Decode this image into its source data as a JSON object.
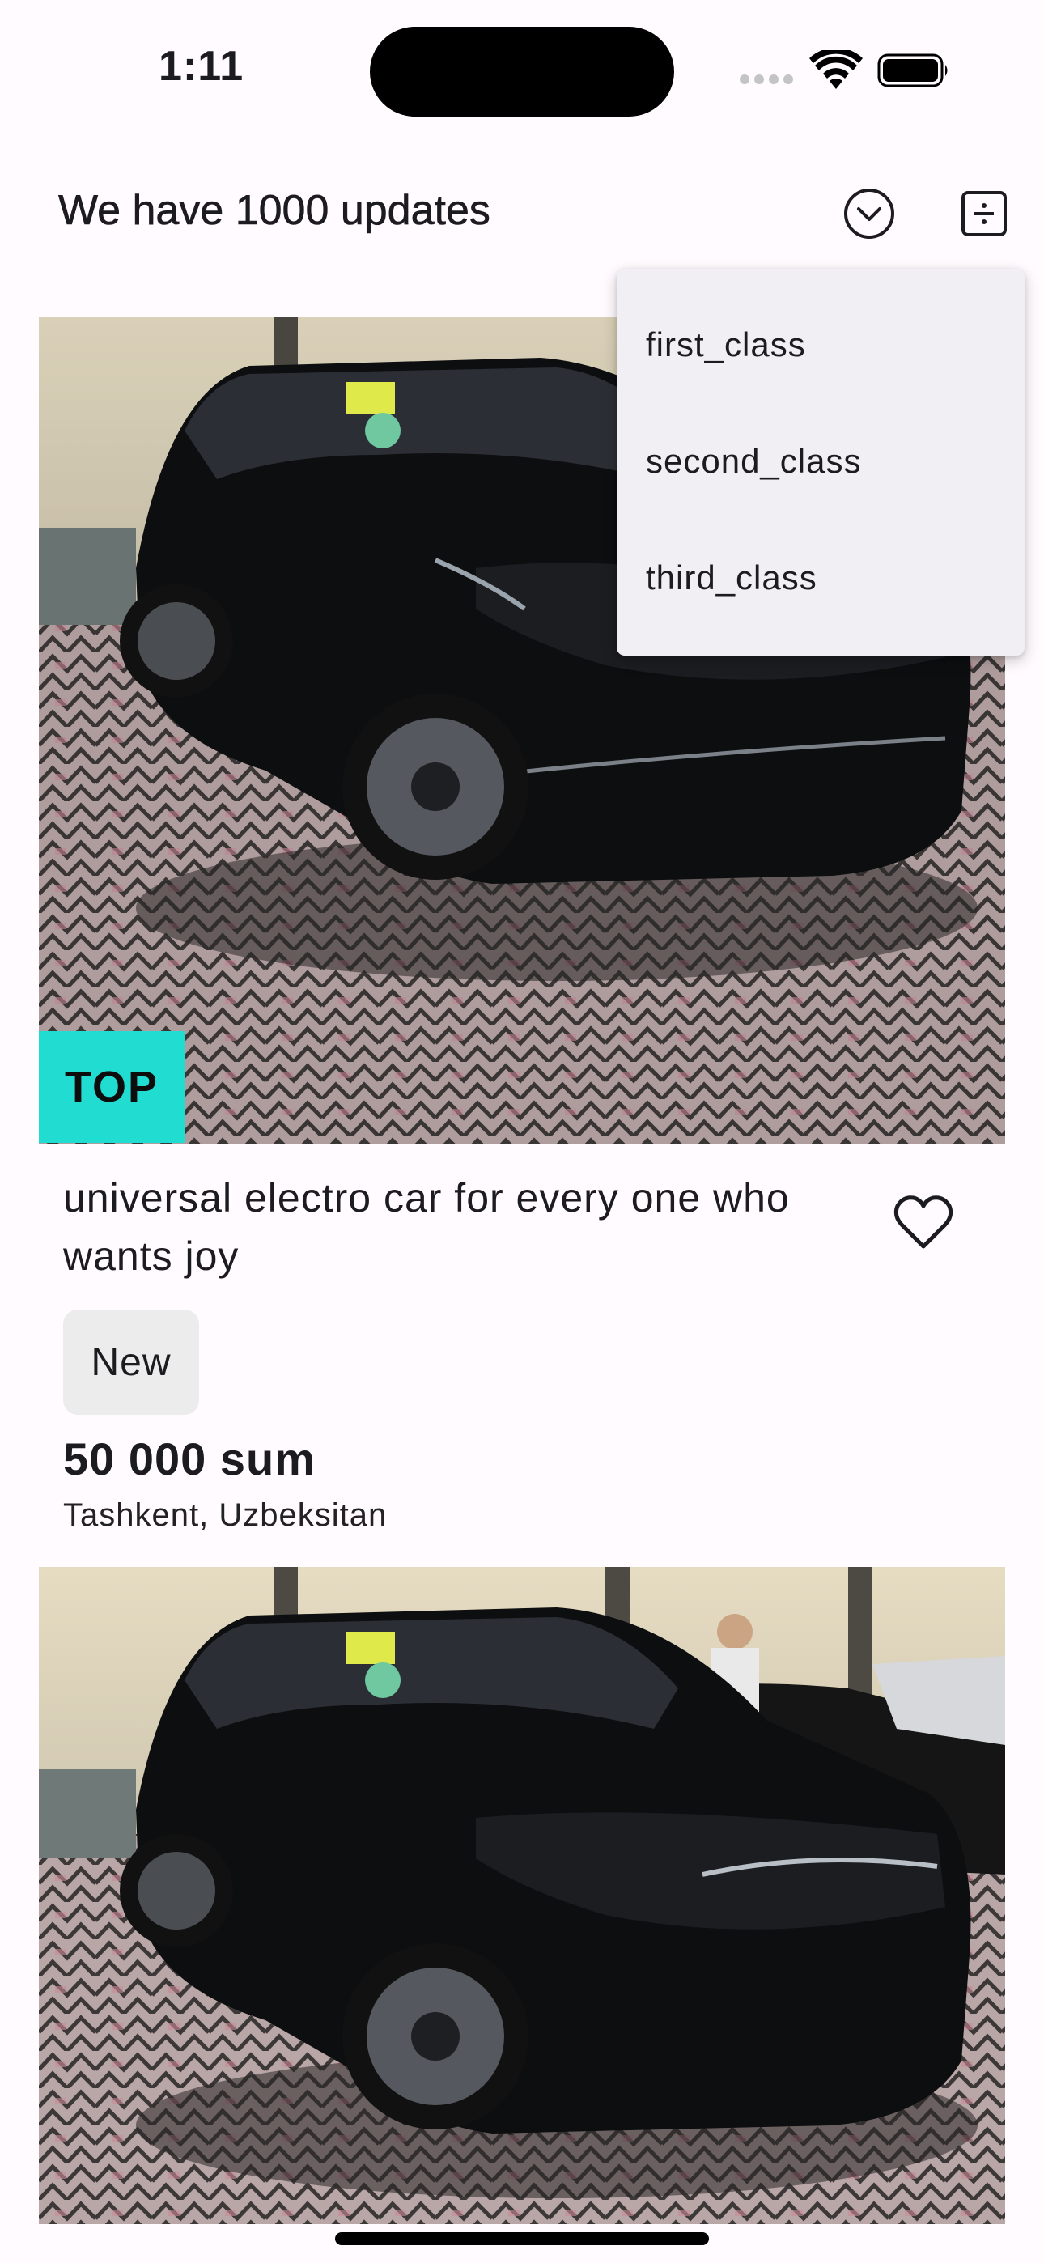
{
  "status_bar": {
    "time": "1:11"
  },
  "app_bar": {
    "title": "We have 1000 updates",
    "sort_icon": "chevron-down-circle-icon",
    "filter_icon": "calculator-icon"
  },
  "dropdown_menu": {
    "items": [
      "first_class",
      "second_class",
      "third_class"
    ]
  },
  "listings": [
    {
      "badge": "TOP",
      "title": "universal electro car for every one who wants joy",
      "condition": "New",
      "price": "50 000 sum",
      "location": "Tashkent, Uzbeksitan",
      "favorite_icon": "heart-outline-icon"
    }
  ],
  "colors": {
    "background": "#fffbfe",
    "top_badge": "#21dcd0",
    "menu_background": "#f2eff4",
    "chip_background": "#ececec"
  }
}
